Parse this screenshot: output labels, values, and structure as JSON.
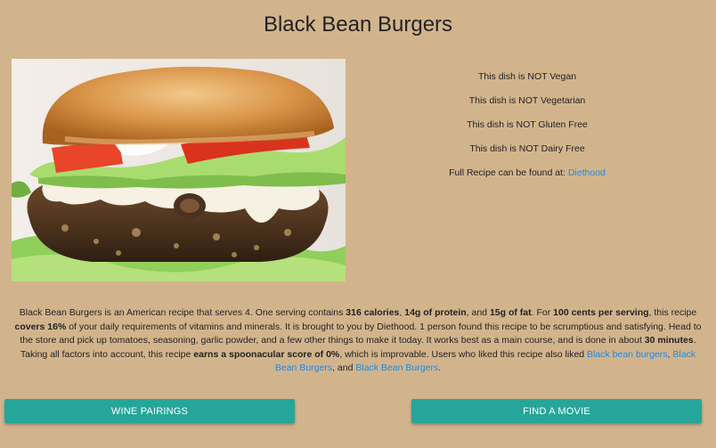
{
  "recipe": {
    "title": "Black Bean Burgers",
    "image_alt": "black-bean-burger-photo"
  },
  "diet": {
    "vegan": "This dish is NOT Vegan",
    "vegetarian": "This dish is NOT Vegetarian",
    "gluten_free": "This dish is NOT Gluten Free",
    "dairy_free": "This dish is NOT Dairy Free",
    "full_recipe_prefix": "Full Recipe can be found at:",
    "source_link": "Diethood"
  },
  "summary": {
    "p1": "Black Bean Burgers is an American recipe that serves 4. One serving contains ",
    "calories": "316 calories",
    "sep1": ", ",
    "protein": "14g of protein",
    "sep2": ", and ",
    "fat": "15g of fat",
    "p2": ". For ",
    "cost": "100 cents per serving",
    "p3": ", this recipe ",
    "covers": "covers 16%",
    "p4": " of your daily requirements of vitamins and minerals. It is brought to you by Diethood. 1 person found this recipe to be scrumptious and satisfying. Head to the store and pick up tomatoes, seasoning, garlic powder, and a few other things to make it today. It works best as a main course, and is done in about ",
    "time": "30 minutes",
    "p5": ". Taking all factors into account, this recipe ",
    "score": "earns a spoonacular score of 0%",
    "p6": ", which is improvable. Users who liked this recipe also liked ",
    "link1": "Black bean burgers",
    "sep3": ", ",
    "link2": "Black Bean Burgers",
    "sep4": ", and ",
    "link3": "Black Bean Burgers",
    "end": "."
  },
  "buttons": {
    "wine": "WINE PAIRINGS",
    "movie": "FIND A MOVIE"
  },
  "colors": {
    "background": "#d2b48c",
    "button": "#26a69a",
    "link": "#1e88e5"
  }
}
